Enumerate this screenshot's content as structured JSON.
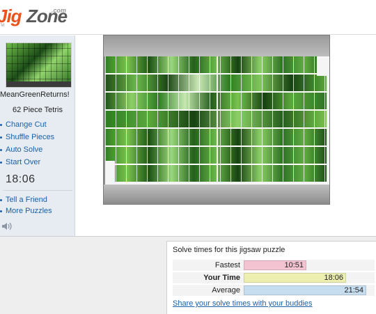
{
  "logo": {
    "jig": "Jig",
    "zone": "Zone",
    "com": ".com",
    "tm": "TM"
  },
  "sidebar": {
    "puzzle_name": "MeanGreenReturns!",
    "piece_info": "62 Piece Tetris",
    "links": [
      {
        "label": "Change Cut"
      },
      {
        "label": "Shuffle Pieces"
      },
      {
        "label": "Auto Solve"
      },
      {
        "label": "Start Over"
      }
    ],
    "timer": "18:06",
    "links2": [
      {
        "label": "Tell a Friend"
      },
      {
        "label": "More Puzzles"
      }
    ],
    "sound_icon": "speaker-icon"
  },
  "solve_times": {
    "title": "Solve times for this jigsaw puzzle",
    "rows": [
      {
        "label": "Fastest",
        "value": "10:51",
        "color": "#f3c3d2",
        "bold": false
      },
      {
        "label": "Your Time",
        "value": "18:06",
        "color": "#ecefb0",
        "bold": true
      },
      {
        "label": "Average",
        "value": "21:54",
        "color": "#c6ddf0",
        "bold": false
      }
    ],
    "share_link": "Share your solve times with your buddies"
  },
  "colors": {
    "sidebar_bg": "#e7ecf2",
    "link": "#1a5fa8",
    "logo_accent": "#e8541b"
  }
}
